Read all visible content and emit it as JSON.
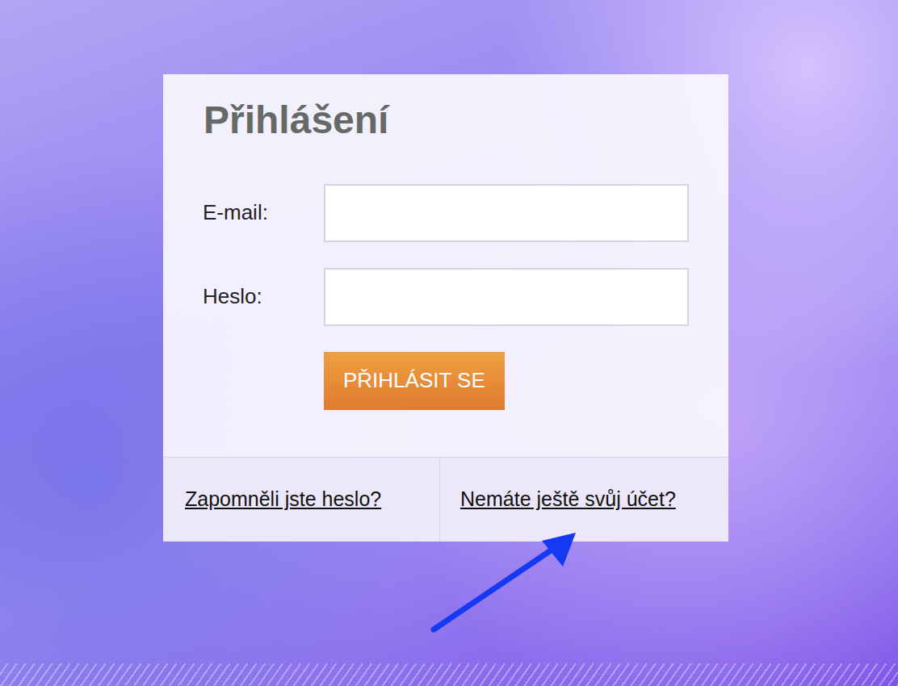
{
  "login": {
    "title": "Přihlášení",
    "fields": [
      {
        "label": "E-mail:",
        "type": "email",
        "value": ""
      },
      {
        "label": "Heslo:",
        "type": "password",
        "value": ""
      }
    ],
    "submit": "PŘIHLÁSIT SE",
    "links": [
      {
        "label": "Zapomněli jste heslo?",
        "pointed": false
      },
      {
        "label": "Nemáte ještě svůj účet?",
        "pointed": true
      }
    ]
  }
}
